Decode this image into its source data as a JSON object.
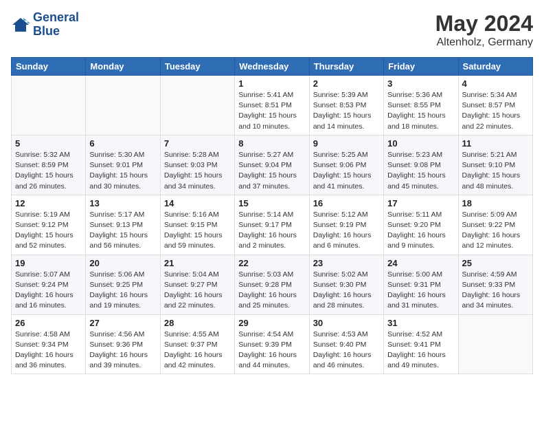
{
  "header": {
    "logo_line1": "General",
    "logo_line2": "Blue",
    "month_year": "May 2024",
    "location": "Altenholz, Germany"
  },
  "weekdays": [
    "Sunday",
    "Monday",
    "Tuesday",
    "Wednesday",
    "Thursday",
    "Friday",
    "Saturday"
  ],
  "weeks": [
    [
      {
        "day": "",
        "info": ""
      },
      {
        "day": "",
        "info": ""
      },
      {
        "day": "",
        "info": ""
      },
      {
        "day": "1",
        "info": "Sunrise: 5:41 AM\nSunset: 8:51 PM\nDaylight: 15 hours\nand 10 minutes."
      },
      {
        "day": "2",
        "info": "Sunrise: 5:39 AM\nSunset: 8:53 PM\nDaylight: 15 hours\nand 14 minutes."
      },
      {
        "day": "3",
        "info": "Sunrise: 5:36 AM\nSunset: 8:55 PM\nDaylight: 15 hours\nand 18 minutes."
      },
      {
        "day": "4",
        "info": "Sunrise: 5:34 AM\nSunset: 8:57 PM\nDaylight: 15 hours\nand 22 minutes."
      }
    ],
    [
      {
        "day": "5",
        "info": "Sunrise: 5:32 AM\nSunset: 8:59 PM\nDaylight: 15 hours\nand 26 minutes."
      },
      {
        "day": "6",
        "info": "Sunrise: 5:30 AM\nSunset: 9:01 PM\nDaylight: 15 hours\nand 30 minutes."
      },
      {
        "day": "7",
        "info": "Sunrise: 5:28 AM\nSunset: 9:03 PM\nDaylight: 15 hours\nand 34 minutes."
      },
      {
        "day": "8",
        "info": "Sunrise: 5:27 AM\nSunset: 9:04 PM\nDaylight: 15 hours\nand 37 minutes."
      },
      {
        "day": "9",
        "info": "Sunrise: 5:25 AM\nSunset: 9:06 PM\nDaylight: 15 hours\nand 41 minutes."
      },
      {
        "day": "10",
        "info": "Sunrise: 5:23 AM\nSunset: 9:08 PM\nDaylight: 15 hours\nand 45 minutes."
      },
      {
        "day": "11",
        "info": "Sunrise: 5:21 AM\nSunset: 9:10 PM\nDaylight: 15 hours\nand 48 minutes."
      }
    ],
    [
      {
        "day": "12",
        "info": "Sunrise: 5:19 AM\nSunset: 9:12 PM\nDaylight: 15 hours\nand 52 minutes."
      },
      {
        "day": "13",
        "info": "Sunrise: 5:17 AM\nSunset: 9:13 PM\nDaylight: 15 hours\nand 56 minutes."
      },
      {
        "day": "14",
        "info": "Sunrise: 5:16 AM\nSunset: 9:15 PM\nDaylight: 15 hours\nand 59 minutes."
      },
      {
        "day": "15",
        "info": "Sunrise: 5:14 AM\nSunset: 9:17 PM\nDaylight: 16 hours\nand 2 minutes."
      },
      {
        "day": "16",
        "info": "Sunrise: 5:12 AM\nSunset: 9:19 PM\nDaylight: 16 hours\nand 6 minutes."
      },
      {
        "day": "17",
        "info": "Sunrise: 5:11 AM\nSunset: 9:20 PM\nDaylight: 16 hours\nand 9 minutes."
      },
      {
        "day": "18",
        "info": "Sunrise: 5:09 AM\nSunset: 9:22 PM\nDaylight: 16 hours\nand 12 minutes."
      }
    ],
    [
      {
        "day": "19",
        "info": "Sunrise: 5:07 AM\nSunset: 9:24 PM\nDaylight: 16 hours\nand 16 minutes."
      },
      {
        "day": "20",
        "info": "Sunrise: 5:06 AM\nSunset: 9:25 PM\nDaylight: 16 hours\nand 19 minutes."
      },
      {
        "day": "21",
        "info": "Sunrise: 5:04 AM\nSunset: 9:27 PM\nDaylight: 16 hours\nand 22 minutes."
      },
      {
        "day": "22",
        "info": "Sunrise: 5:03 AM\nSunset: 9:28 PM\nDaylight: 16 hours\nand 25 minutes."
      },
      {
        "day": "23",
        "info": "Sunrise: 5:02 AM\nSunset: 9:30 PM\nDaylight: 16 hours\nand 28 minutes."
      },
      {
        "day": "24",
        "info": "Sunrise: 5:00 AM\nSunset: 9:31 PM\nDaylight: 16 hours\nand 31 minutes."
      },
      {
        "day": "25",
        "info": "Sunrise: 4:59 AM\nSunset: 9:33 PM\nDaylight: 16 hours\nand 34 minutes."
      }
    ],
    [
      {
        "day": "26",
        "info": "Sunrise: 4:58 AM\nSunset: 9:34 PM\nDaylight: 16 hours\nand 36 minutes."
      },
      {
        "day": "27",
        "info": "Sunrise: 4:56 AM\nSunset: 9:36 PM\nDaylight: 16 hours\nand 39 minutes."
      },
      {
        "day": "28",
        "info": "Sunrise: 4:55 AM\nSunset: 9:37 PM\nDaylight: 16 hours\nand 42 minutes."
      },
      {
        "day": "29",
        "info": "Sunrise: 4:54 AM\nSunset: 9:39 PM\nDaylight: 16 hours\nand 44 minutes."
      },
      {
        "day": "30",
        "info": "Sunrise: 4:53 AM\nSunset: 9:40 PM\nDaylight: 16 hours\nand 46 minutes."
      },
      {
        "day": "31",
        "info": "Sunrise: 4:52 AM\nSunset: 9:41 PM\nDaylight: 16 hours\nand 49 minutes."
      },
      {
        "day": "",
        "info": ""
      }
    ]
  ]
}
